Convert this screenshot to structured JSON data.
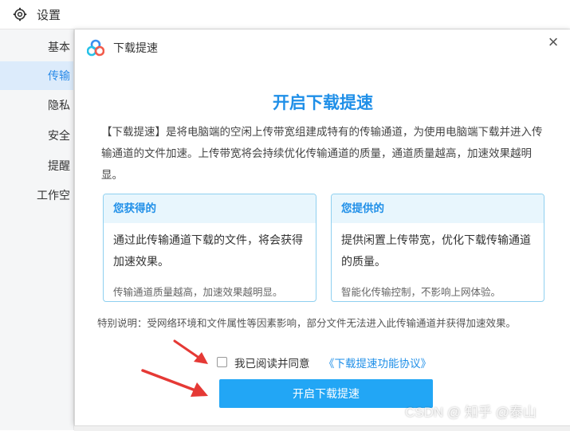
{
  "settings": {
    "title": "设置",
    "side_items": [
      {
        "label": "基本"
      },
      {
        "label": "传输"
      },
      {
        "label": "隐私"
      },
      {
        "label": "安全"
      },
      {
        "label": "提醒"
      },
      {
        "label": "工作空"
      }
    ]
  },
  "dialog": {
    "title": "下载提速",
    "close_label": "×",
    "heading": "开启下载提速",
    "intro": "【下载提速】是将电脑端的空闲上传带宽组建成特有的传输通道，为使用电脑端下载并进入传输通道的文件加速。上传带宽将会持续优化传输通道的质量，通道质量越高，加速效果越明显。",
    "cards": [
      {
        "head": "您获得的",
        "body": "通过此传输通道下载的文件，将会获得加速效果。",
        "foot": "传输通道质量越高，加速效果越明显。"
      },
      {
        "head": "您提供的",
        "body": "提供闲置上传带宽，优化下载传输通道的质量。",
        "foot": "智能化传输控制，不影响上网体验。"
      }
    ],
    "note": "特别说明：受网络环境和文件属性等因素影响，部分文件无法进入此传输通道并获得加速效果。",
    "agree_text": "我已阅读并同意",
    "agree_link": "《下载提速功能协议》",
    "primary_button": "开启下载提速"
  },
  "watermark": "CSDN @ 知乎 @泰山",
  "colors": {
    "accent": "#1f8fe8",
    "button": "#22a6f5",
    "arrow": "#e53935"
  }
}
